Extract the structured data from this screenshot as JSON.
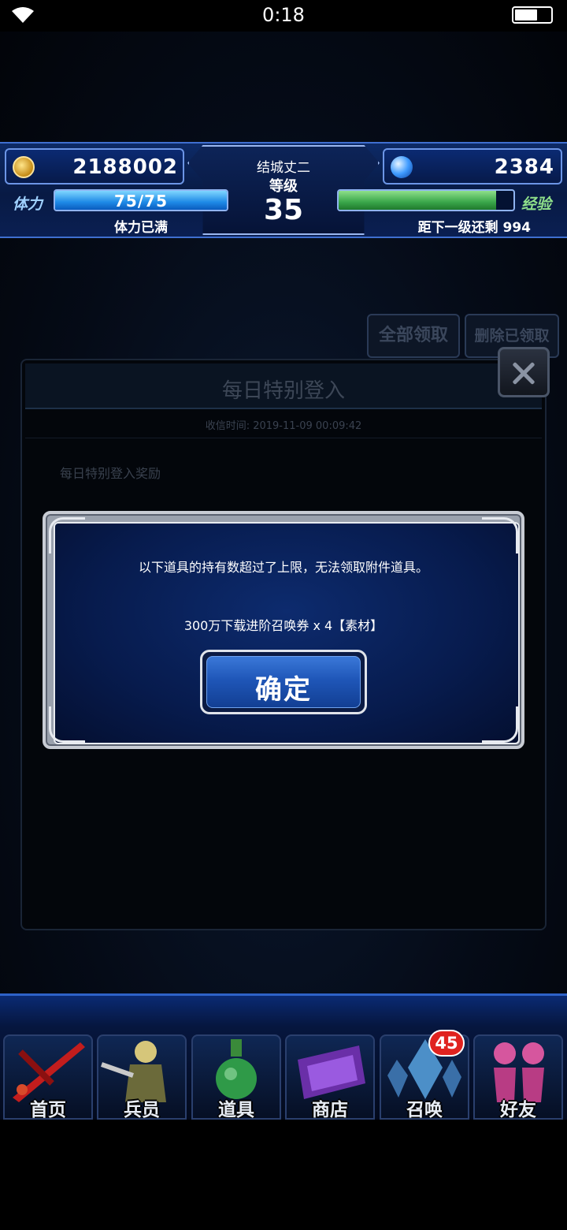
{
  "status_bar": {
    "time": "0:18"
  },
  "hud": {
    "gil": "2188002",
    "gems": "2384",
    "player_name": "结城丈二",
    "level_label": "等级",
    "level": "35",
    "stamina_label": "体力",
    "stamina_value": "75/75",
    "stamina_fraction": 1.0,
    "stamina_status": "体力已满",
    "exp_label": "经验",
    "exp_fraction": 0.9,
    "exp_remaining_label": "距下一级还剩",
    "exp_remaining_value": "994"
  },
  "mail": {
    "claim_all_button": "全部领取",
    "delete_claimed_button": "删除已领取",
    "title": "每日特别登入",
    "received_label": "收信时间:",
    "received_time": "2019-11-09 00:09:42",
    "body": "每日特别登入奖励"
  },
  "alert": {
    "message": "以下道具的持有数超过了上限，无法领取附件道具。",
    "item": "300万下载进阶召唤券 x 4【素材】",
    "confirm_button": "确定"
  },
  "nav": {
    "items": [
      {
        "label": "首页",
        "icon": "sword-icon"
      },
      {
        "label": "兵员",
        "icon": "warrior-icon"
      },
      {
        "label": "道具",
        "icon": "potion-icon"
      },
      {
        "label": "商店",
        "icon": "shop-icon"
      },
      {
        "label": "召唤",
        "icon": "crystal-icon",
        "badge": "45"
      },
      {
        "label": "好友",
        "icon": "friends-icon"
      }
    ]
  }
}
